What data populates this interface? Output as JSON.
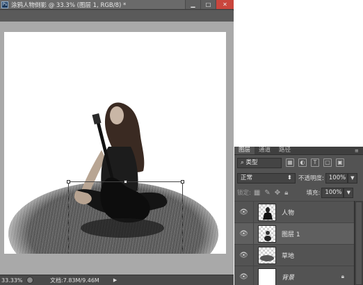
{
  "window": {
    "title": "涂鸦人物倒影 @ 33.3% (图层 1, RGB/8) *",
    "app_icon": "Ps",
    "minimize": "▁",
    "maximize": "□",
    "close": "✕"
  },
  "statusbar": {
    "zoom": "33.33%",
    "doc_size": "文档:7.83M/9.46M",
    "play": "▶"
  },
  "layers_panel": {
    "tabs": [
      {
        "label": "图层"
      },
      {
        "label": "通道"
      },
      {
        "label": "路径"
      }
    ],
    "menu": "≡",
    "filter_kind": "类型",
    "blend_mode": "正常",
    "opacity_label": "不透明度:",
    "opacity_value": "100%",
    "lock_label": "锁定:",
    "fill_label": "填充:",
    "fill_value": "100%",
    "layers": [
      {
        "name": "人物"
      },
      {
        "name": "图层 1"
      },
      {
        "name": "草地"
      },
      {
        "name": "背景"
      }
    ]
  },
  "colors": {
    "panel_bg": "#535353",
    "selected_layer": "#5f5f5f",
    "close_button": "#c9463d"
  }
}
